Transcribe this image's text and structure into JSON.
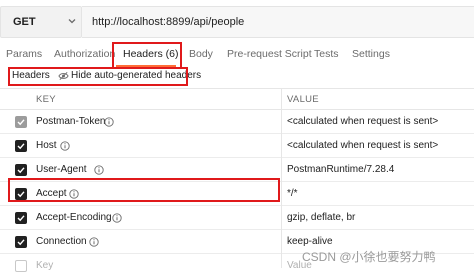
{
  "request": {
    "method": "GET",
    "url": "http://localhost:8899/api/people"
  },
  "tabs": [
    {
      "label": "Params"
    },
    {
      "label": "Authorization"
    },
    {
      "label": "Headers (6)"
    },
    {
      "label": "Body"
    },
    {
      "label": "Pre-request Script"
    },
    {
      "label": "Tests"
    },
    {
      "label": "Settings"
    }
  ],
  "headers_bar": {
    "title": "Headers",
    "toggle_label": "Hide auto-generated headers"
  },
  "table": {
    "columns": {
      "key": "KEY",
      "value": "VALUE"
    },
    "rows": [
      {
        "key": "Postman-Token",
        "value": "<calculated when request is sent>",
        "checked": true,
        "dimmed": true
      },
      {
        "key": "Host",
        "value": "<calculated when request is sent>",
        "checked": true,
        "dimmed": false
      },
      {
        "key": "User-Agent",
        "value": "PostmanRuntime/7.28.4",
        "checked": true,
        "dimmed": false
      },
      {
        "key": "Accept",
        "value": "*/*",
        "checked": true,
        "dimmed": false
      },
      {
        "key": "Accept-Encoding",
        "value": "gzip, deflate, br",
        "checked": true,
        "dimmed": false
      },
      {
        "key": "Connection",
        "value": "keep-alive",
        "checked": true,
        "dimmed": false
      }
    ],
    "new_row": {
      "key_placeholder": "Key",
      "value_placeholder": "Value"
    }
  },
  "watermark": "CSDN @小徐也要努力鸭",
  "colors": {
    "active_tab_underline": "#ff6c37",
    "highlight_box": "#e0191b",
    "checkbox": "#212121"
  }
}
